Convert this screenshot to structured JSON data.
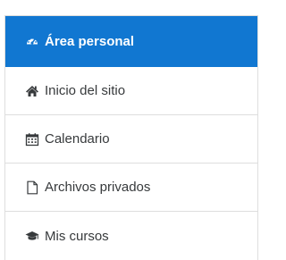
{
  "nav": {
    "items": [
      {
        "label": "Área personal",
        "icon": "dashboard-icon",
        "active": true
      },
      {
        "label": "Inicio del sitio",
        "icon": "home-icon",
        "active": false
      },
      {
        "label": "Calendario",
        "icon": "calendar-icon",
        "active": false
      },
      {
        "label": "Archivos privados",
        "icon": "file-icon",
        "active": false
      },
      {
        "label": "Mis cursos",
        "icon": "graduation-cap-icon",
        "active": false
      }
    ]
  },
  "colors": {
    "accent": "#1177d1",
    "text": "#373a3c",
    "border": "#dedede"
  }
}
